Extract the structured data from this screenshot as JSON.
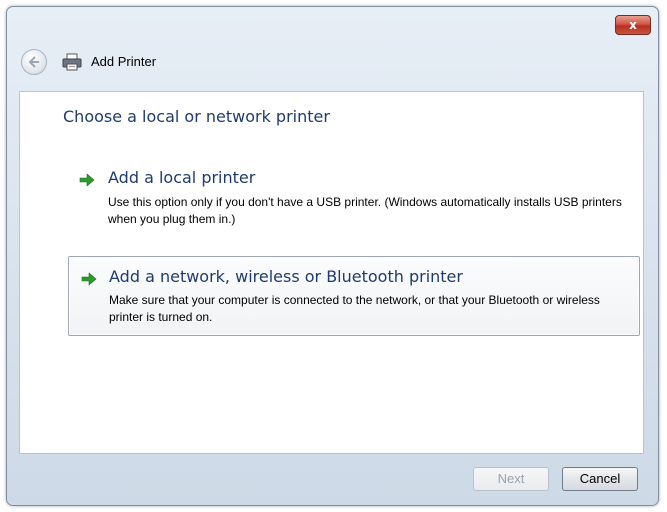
{
  "window": {
    "title": "Add Printer",
    "close_label": "x"
  },
  "content": {
    "heading": "Choose a local or network printer",
    "options": [
      {
        "title": "Add a local printer",
        "description": "Use this option only if you don't have a USB printer. (Windows automatically installs USB printers when you plug them in.)"
      },
      {
        "title": "Add a network, wireless or Bluetooth printer",
        "description": "Make sure that your computer is connected to the network, or that your Bluetooth or wireless printer is turned on."
      }
    ]
  },
  "footer": {
    "next_label": "Next",
    "cancel_label": "Cancel"
  },
  "icons": {
    "back": "back-arrow-icon",
    "printer": "printer-icon",
    "option_arrow": "green-arrow-icon",
    "close": "close-icon"
  },
  "colors": {
    "heading": "#1f3b6e",
    "arrow": "#2e9a2e",
    "close": "#c9533f"
  }
}
